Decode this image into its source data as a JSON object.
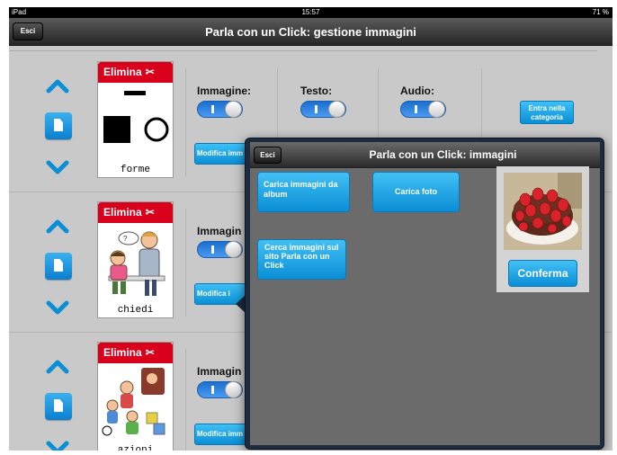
{
  "status_bar": {
    "device": "iPad",
    "wifi_icon": "wifi-icon",
    "time": "15:57",
    "battery": "71 %",
    "battery_icon": "battery-icon"
  },
  "nav": {
    "back_label": "Esci",
    "title": "Parla con un Click: gestione immagini"
  },
  "rows": [
    {
      "delete_label": "Elimina",
      "delete_icon": "scissors-icon",
      "card_label": "forme",
      "image_label": "Immagine:",
      "text_label": "Testo:",
      "audio_label": "Audio:",
      "modify_label": "Modifica imm",
      "image_toggle": true,
      "text_toggle": true,
      "audio_toggle": true
    },
    {
      "delete_label": "Elimina",
      "delete_icon": "scissors-icon",
      "card_label": "chiedi",
      "image_label": "Immagin",
      "modify_label": "Modifica i",
      "image_toggle": true
    },
    {
      "delete_label": "Elimina",
      "delete_icon": "scissors-icon",
      "card_label": "azioni",
      "image_label": "Immagin",
      "modify_label": "Modifica imm",
      "image_toggle": true
    }
  ],
  "category_button": "Entra nella categoria",
  "popover": {
    "back_label": "Esci",
    "title": "Parla con un Click: immagini",
    "album_button": "Carica immagini da album",
    "photo_button": "Carica foto",
    "search_button": "Cerca immagini sul sito Parla con un Click",
    "confirm_button": "Conferma"
  },
  "colors": {
    "accent": "#0a8fd6",
    "delete_red": "#d8001a",
    "nav_dark": "#262626"
  }
}
